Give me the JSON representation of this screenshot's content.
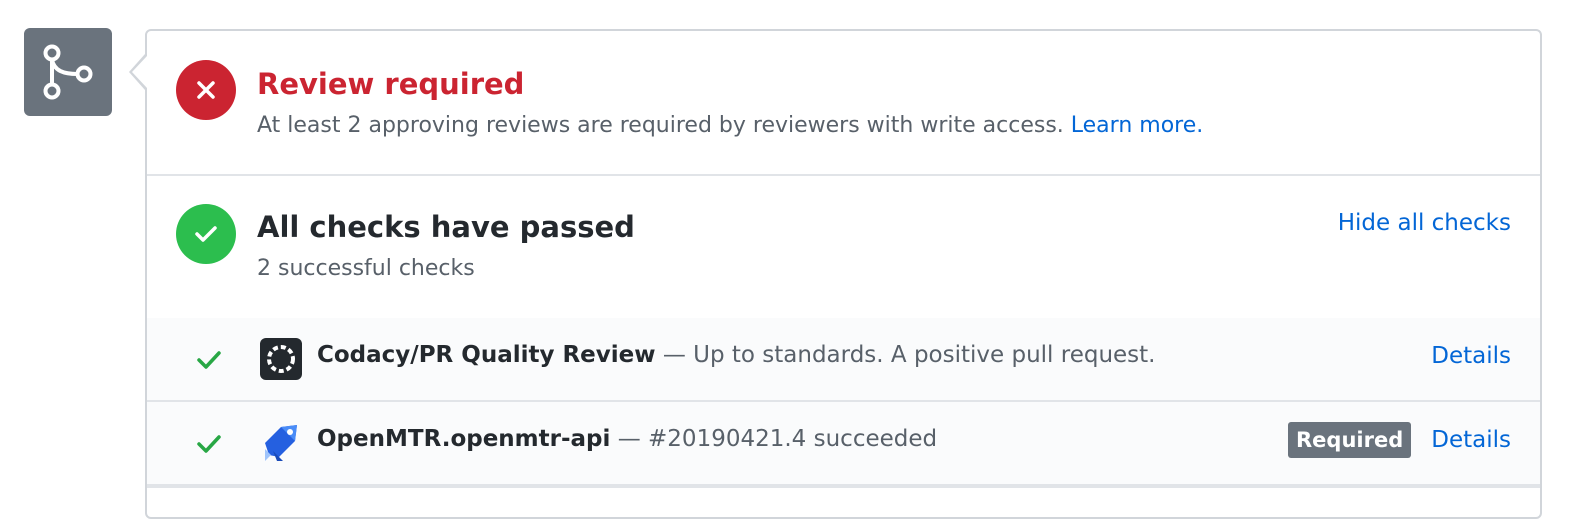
{
  "merge_status": {
    "icon": "git-merge-icon",
    "color": "#6a737d"
  },
  "review": {
    "title": "Review required",
    "description": "At least 2 approving reviews are required by reviewers with write access.",
    "learn_more": "Learn more.",
    "status_icon": "x-icon",
    "status_color": "#cb2431"
  },
  "checks_summary": {
    "title": "All checks have passed",
    "subtitle": "2 successful checks",
    "hide_link": "Hide all checks",
    "status_icon": "check-icon",
    "status_color": "#2cbe4e"
  },
  "checks": [
    {
      "name": "Codacy/PR Quality Review",
      "separator": "—",
      "description": "Up to standards. A positive pull request.",
      "details": "Details",
      "logo": "codacy-logo",
      "required": ""
    },
    {
      "name": "OpenMTR.openmtr-api",
      "separator": "—",
      "description": "#20190421.4 succeeded",
      "details": "Details",
      "logo": "azure-pipelines-logo",
      "required": "Required"
    }
  ]
}
